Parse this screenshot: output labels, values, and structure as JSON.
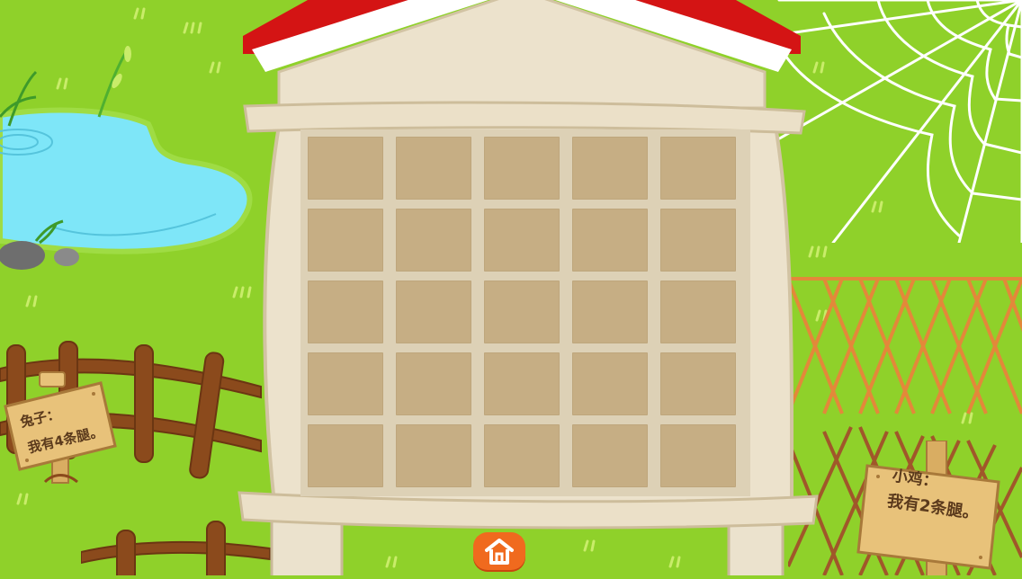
{
  "colors": {
    "grass": "#8fd12a",
    "pond": "#7ee6f8",
    "roof_red": "#d41414",
    "shelf_cream": "#ece2cc",
    "slot_tan": "#c6ae84",
    "fence_brown": "#8b4a1c",
    "lattice_orange": "#e3883a",
    "sign_wood": "#e8c27a",
    "home_orange": "#f06a1e"
  },
  "shelf": {
    "rows": 5,
    "columns": 5,
    "slot_count": 25
  },
  "signs": {
    "rabbit": {
      "name": "兔子：",
      "line": "我有4条腿。"
    },
    "chick": {
      "name": "小鸡：",
      "line": "我有2条腿。"
    }
  },
  "controls": {
    "home_icon": "home-icon"
  }
}
